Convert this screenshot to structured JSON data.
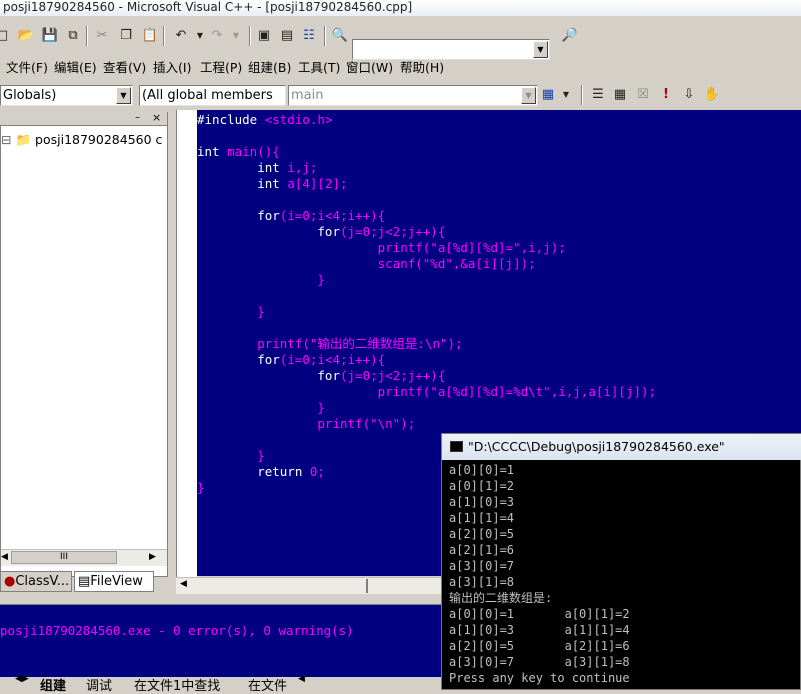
{
  "window": {
    "title": "posji18790284560 - Microsoft Visual C++ - [posji18790284560.cpp]"
  },
  "menu": [
    "文件(F)",
    "编辑(E)",
    "查看(V)",
    "插入(I)",
    "工程(P)",
    "组建(B)",
    "工具(T)",
    "窗口(W)",
    "帮助(H)"
  ],
  "toolbar": {
    "find_value": "",
    "scope_combo": "Globals)",
    "members_combo": "(All global members",
    "function_combo": "main"
  },
  "workspace": {
    "tree_root": "posji18790284560 c",
    "tabs": [
      "ClassV...",
      "FileView"
    ],
    "scroll_glyph": "III"
  },
  "editor": {
    "lines": [
      [
        {
          "t": "#include ",
          "c": "kw"
        },
        {
          "t": "<stdio.h>",
          "c": "mg"
        }
      ],
      [],
      [
        {
          "t": "int ",
          "c": "kw"
        },
        {
          "t": "main(){",
          "c": "mg"
        }
      ],
      [
        {
          "t": "        int ",
          "c": "kw"
        },
        {
          "t": "i,j;",
          "c": "mg"
        }
      ],
      [
        {
          "t": "        int ",
          "c": "kw"
        },
        {
          "t": "a[4][2];",
          "c": "mg"
        }
      ],
      [],
      [
        {
          "t": "        for",
          "c": "kw"
        },
        {
          "t": "(i=0;i<4;i++){",
          "c": "mg"
        }
      ],
      [
        {
          "t": "                for",
          "c": "kw"
        },
        {
          "t": "(j=0;j<2;j++){",
          "c": "mg"
        }
      ],
      [
        {
          "t": "                        printf(\"a[%d][%d]=\",i,j);",
          "c": "mg"
        }
      ],
      [
        {
          "t": "                        scanf(\"%d\",&a[i][j]);",
          "c": "mg"
        }
      ],
      [
        {
          "t": "                }",
          "c": "mg"
        }
      ],
      [],
      [
        {
          "t": "        }",
          "c": "mg"
        }
      ],
      [],
      [
        {
          "t": "        printf(\"输出的二维数组是:\\n\");",
          "c": "mg"
        }
      ],
      [
        {
          "t": "        for",
          "c": "kw"
        },
        {
          "t": "(i=0;i<4;i++){",
          "c": "mg"
        }
      ],
      [
        {
          "t": "                for",
          "c": "kw"
        },
        {
          "t": "(j=0;j<2;j++){",
          "c": "mg"
        }
      ],
      [
        {
          "t": "                        printf(\"a[%d][%d]=%d\\t\",i,j,a[i][j]);",
          "c": "mg"
        }
      ],
      [
        {
          "t": "                }",
          "c": "mg"
        }
      ],
      [
        {
          "t": "                printf(\"\\n\");",
          "c": "mg"
        }
      ],
      [],
      [
        {
          "t": "        }",
          "c": "mg"
        }
      ],
      [
        {
          "t": "        return ",
          "c": "kw"
        },
        {
          "t": "0;",
          "c": "mg"
        }
      ],
      [
        {
          "t": "}",
          "c": "mg"
        }
      ]
    ]
  },
  "output": {
    "message": "posji18790284560.exe - 0 error(s), 0 warning(s)",
    "tabs": [
      "组建",
      "调试",
      "在文件1中查找",
      "在文件"
    ]
  },
  "console": {
    "title": "\"D:\\CCCC\\Debug\\posji18790284560.exe\"",
    "lines": [
      "a[0][0]=1",
      "a[0][1]=2",
      "a[1][0]=3",
      "a[1][1]=4",
      "a[2][0]=5",
      "a[2][1]=6",
      "a[3][0]=7",
      "a[3][1]=8",
      "输出的二维数组是:",
      "a[0][0]=1       a[0][1]=2",
      "a[1][0]=3       a[1][1]=4",
      "a[2][0]=5       a[2][1]=6",
      "a[3][0]=7       a[3][1]=8",
      "Press any key to continue"
    ]
  }
}
